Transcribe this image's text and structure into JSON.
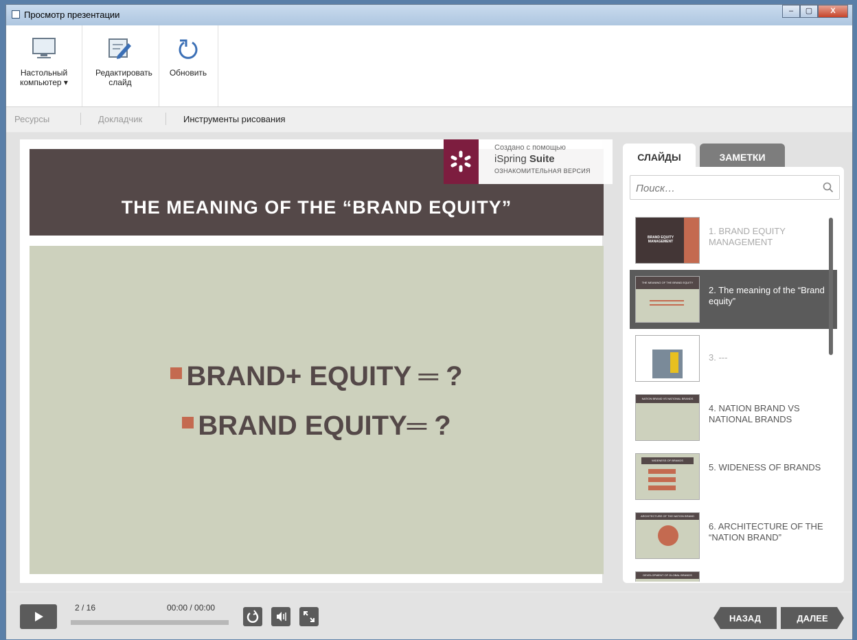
{
  "window": {
    "title": "Просмотр презентации",
    "controls": [
      "–",
      "▢",
      "X"
    ]
  },
  "toolbar": {
    "desktop_label": "Настольный компьютер ▾",
    "edit_label": "Редактировать слайд",
    "refresh_label": "Обновить"
  },
  "tabs": [
    "Ресурсы",
    "Докладчик",
    "Инструменты рисования"
  ],
  "slide": {
    "title": "THE MEANING OF THE “BRAND EQUITY”",
    "bullets": [
      "BRAND+ EQUITY ═ ?",
      "BRAND EQUITY═ ?"
    ],
    "watermark": {
      "line1": "Создано с помощью",
      "line2_a": "iSpring ",
      "line2_b": "Suite",
      "line3": "ОЗНАКОМИТЕЛЬНАЯ ВЕРСИЯ"
    }
  },
  "panel": {
    "tab_slides": "СЛАЙДЫ",
    "tab_notes": "ЗАМЕТКИ",
    "search_placeholder": "Поиск…",
    "slides": [
      {
        "label": "1. BRAND EQUITY MANAGEMENT",
        "thumb_text": "BRAND EQUITY MANAGEMENT",
        "state": "dim"
      },
      {
        "label": "2. The meaning of the “Brand equity”",
        "thumb_text": "THE MEANING OF THE BRAND EQUITY",
        "state": "active"
      },
      {
        "label": "3. ---",
        "thumb_text": "",
        "state": "dim"
      },
      {
        "label": "4. NATION BRAND VS NATIONAL BRANDS",
        "thumb_text": "NATION BRAND VS NATIONAL BRANDS",
        "state": "normal"
      },
      {
        "label": "5. WIDENESS OF BRANDS",
        "thumb_text": "WIDENESS OF BRANDS",
        "state": "normal"
      },
      {
        "label": "6. ARCHITECTURE OF THE “NATION BRAND”",
        "thumb_text": "ARCHITECTURE OF THE NATION BRAND",
        "state": "normal"
      },
      {
        "label": "",
        "thumb_text": "DEVELOPMENT OF GLOBAL BRANDS",
        "state": "normal"
      }
    ]
  },
  "player": {
    "slide_counter": "2 / 16",
    "time": "00:00 / 00:00",
    "back": "НАЗАД",
    "next": "ДАЛЕЕ"
  },
  "colors": {
    "slide_title_bg": "#544848",
    "slide_body_bg": "#cdd1bd",
    "bullet_accent": "#c46a50",
    "ispring_logo": "#7d1d3f",
    "control_bg": "#5b5b5b"
  }
}
